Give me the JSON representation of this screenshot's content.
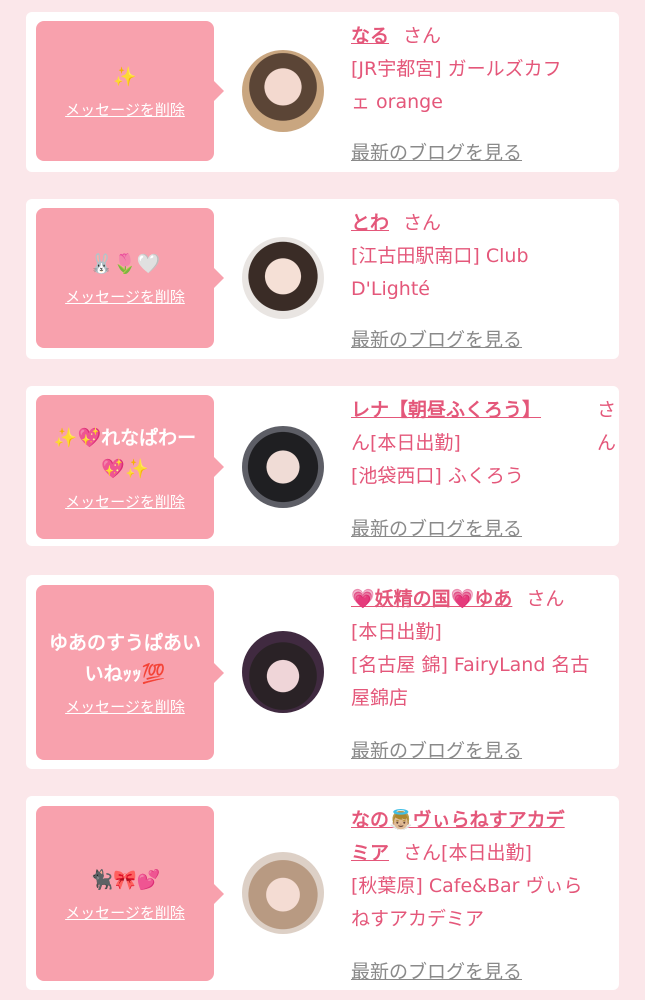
{
  "delete_label": "メッセージを削除",
  "blog_label": "最新のブログを見る",
  "suffix": "さん",
  "items": [
    {
      "message": "✨",
      "name": "なる",
      "lines": [
        "[JR宇都宮] ガールズカフ",
        "ェ orange"
      ]
    },
    {
      "message": "🐰🌷🤍",
      "name": "とわ",
      "lines": [
        "[江古田駅南口] Club",
        "D'Lighté"
      ]
    },
    {
      "message": "✨💖れなぱわー💖✨",
      "name": "レナ【朝昼ふくろう】",
      "lines": [
        "ん[本日出勤]",
        "[池袋西口] ふくろう"
      ]
    },
    {
      "message": "ゆあのすうぱあいいねｯｯ💯",
      "name": "💗妖精の国💗ゆあ",
      "lines": [
        "[本日出勤]",
        "[名古屋 錦] FairyLand 名古",
        "屋錦店"
      ]
    },
    {
      "message": "🐈‍⬛🎀💕",
      "name_line1": "なの👼🏼ヴぃらねすアカデ",
      "name_line2": "ミア",
      "tail": "[本日出勤]",
      "lines": [
        "[秋葉原] Cafe&Bar ヴぃら",
        "ねすアカデミア"
      ]
    }
  ],
  "colors": {
    "background": "#fbe7ea",
    "bubble": "#f8a1ad",
    "name": "#e4577a",
    "link": "#8a8a8a"
  }
}
